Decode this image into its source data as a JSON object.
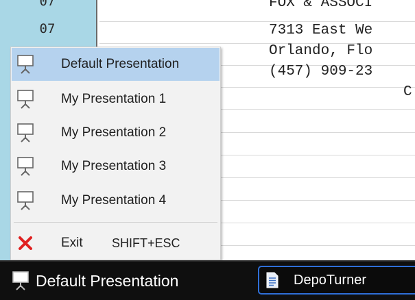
{
  "transcript": {
    "line_numbers": [
      "07",
      "07"
    ],
    "lines": [
      "FOX & ASSOCI",
      "7313 East We",
      "Orlando, Flo",
      "(457) 909-23",
      "C"
    ]
  },
  "menu": {
    "items": [
      {
        "label": "Default Presentation",
        "icon": "presentation-screen-icon",
        "selected": true
      },
      {
        "label": "My Presentation 1",
        "icon": "presentation-screen-icon"
      },
      {
        "label": "My Presentation 2",
        "icon": "presentation-screen-icon"
      },
      {
        "label": "My Presentation 3",
        "icon": "presentation-screen-icon"
      },
      {
        "label": "My Presentation 4",
        "icon": "presentation-screen-icon"
      }
    ],
    "exit": {
      "label": "Exit",
      "shortcut": "SHIFT+ESC",
      "icon": "close-x-icon"
    }
  },
  "taskbar": {
    "presentation_label": "Default Presentation",
    "app_label": "DepoTurner",
    "app_icon": "document-icon"
  },
  "colors": {
    "gutter": "#a9d7e6",
    "menu_selected": "#b5d2ee",
    "taskbar": "#0f0f0f",
    "app_border": "#2f6fd8",
    "exit_x": "#e02020"
  }
}
